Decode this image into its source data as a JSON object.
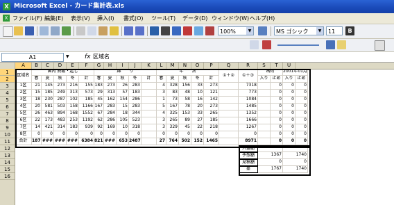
{
  "titlebar": {
    "title": "Microsoft Excel - カード集計表.xls"
  },
  "menu": {
    "items": [
      "ファイル(F)",
      "編集(E)",
      "表示(V)",
      "挿入(I)",
      "書式(O)",
      "ツール(T)",
      "データ(D)",
      "ウィンドウ(W)",
      "ヘルプ(H)"
    ]
  },
  "toolbar": {
    "zoom": "100%",
    "font": "MS ゴシック",
    "font_size": "11",
    "right_label": "B"
  },
  "formula_bar": {
    "name_box": "A1",
    "fx": "fx",
    "value": "区域名"
  },
  "sheet": {
    "columns": [
      "A",
      "B",
      "C",
      "D",
      "E",
      "F",
      "G",
      "H",
      "I",
      "J",
      "K",
      "L",
      "M",
      "N",
      "O",
      "P",
      "Q",
      "R",
      "S",
      "T",
      "U"
    ],
    "rows": [
      "1",
      "2",
      "3",
      "4",
      "5",
      "6",
      "7",
      "8",
      "9",
      "10",
      "11",
      "12",
      "13",
      "14",
      "15",
      "16"
    ],
    "header": {
      "area": "区域名",
      "g1": "国内 熱朝・起し",
      "g2": "綿　　り",
      "g3": "年　　法",
      "sum1": "①＋②",
      "sum2": "①＋③",
      "ship": "出荷",
      "ship_in": "入り",
      "ship_out": "止め",
      "date": "2001年01月",
      "date_in": "入り",
      "date_out": "止め",
      "sub": [
        "春",
        "夏",
        "秋",
        "冬",
        "計"
      ]
    },
    "data": [
      [
        "1区",
        "21",
        "145",
        "273",
        "216",
        "155",
        "",
        "183",
        "273",
        "26",
        "283",
        "",
        "4",
        "328",
        "156",
        "33",
        "273",
        "",
        "7318",
        "1228",
        "",
        "0",
        "0",
        "0",
        "0"
      ],
      [
        "2区",
        "15",
        "185",
        "249",
        "313",
        "573",
        "",
        "29",
        "313",
        "57",
        "183",
        "",
        "3",
        "83",
        "48",
        "10",
        "121",
        "",
        "773",
        "694",
        "",
        "0",
        "0",
        "0",
        "0"
      ],
      [
        "3区",
        "18",
        "230",
        "287",
        "102",
        "185",
        "",
        "45",
        "162",
        "154",
        "286",
        "",
        "1",
        "73",
        "58",
        "16",
        "142",
        "",
        "1084",
        "351",
        "",
        "0",
        "0",
        "0",
        "0"
      ],
      [
        "4区",
        "20",
        "581",
        "503",
        "158",
        "1166",
        "",
        "167",
        "283",
        "15",
        "283",
        "",
        "5",
        "167",
        "78",
        "20",
        "273",
        "",
        "1485",
        "1367",
        "",
        "0",
        "0",
        "0",
        "0"
      ],
      [
        "5区",
        "26",
        "463",
        "894",
        "168",
        "1552",
        "",
        "67",
        "284",
        "18",
        "344",
        "",
        "4",
        "325",
        "153",
        "33",
        "265",
        "",
        "1352",
        "1252",
        "",
        "0",
        "0",
        "0",
        "0"
      ],
      [
        "6区",
        "22",
        "173",
        "483",
        "253",
        "1192",
        "",
        "62",
        "286",
        "105",
        "523",
        "",
        "3",
        "265",
        "89",
        "27",
        "185",
        "",
        "1666",
        "1370",
        "",
        "0",
        "0",
        "0",
        "0"
      ],
      [
        "7区",
        "14",
        "421",
        "314",
        "183",
        "939",
        "",
        "92",
        "169",
        "10",
        "318",
        "",
        "3",
        "329",
        "45",
        "22",
        "218",
        "",
        "1267",
        "1156",
        "",
        "0",
        "0",
        "0",
        "0"
      ],
      [
        "8区",
        "0",
        "0",
        "0",
        "0",
        "0",
        "",
        "0",
        "0",
        "0",
        "0",
        "",
        "0",
        "0",
        "0",
        "0",
        "0",
        "",
        "0",
        "0",
        "",
        "0",
        "0",
        "0",
        "0"
      ],
      [
        "合計",
        "187",
        "###",
        "###",
        "###",
        "6384",
        "",
        "821",
        "###",
        "653",
        "2487",
        "",
        "27",
        "764",
        "502",
        "152",
        "1465",
        "",
        "8971",
        "7546",
        "",
        "0",
        "0",
        "0",
        "0"
      ]
    ],
    "summary": [
      {
        "label": "入金額",
        "r": "",
        "t": ""
      },
      {
        "label": "予想額",
        "r": "1367",
        "t": "1740"
      },
      {
        "label": "見積額",
        "r": "0",
        "t": "0"
      },
      {
        "label": "差",
        "r": "1767",
        "t": "1740"
      }
    ]
  }
}
